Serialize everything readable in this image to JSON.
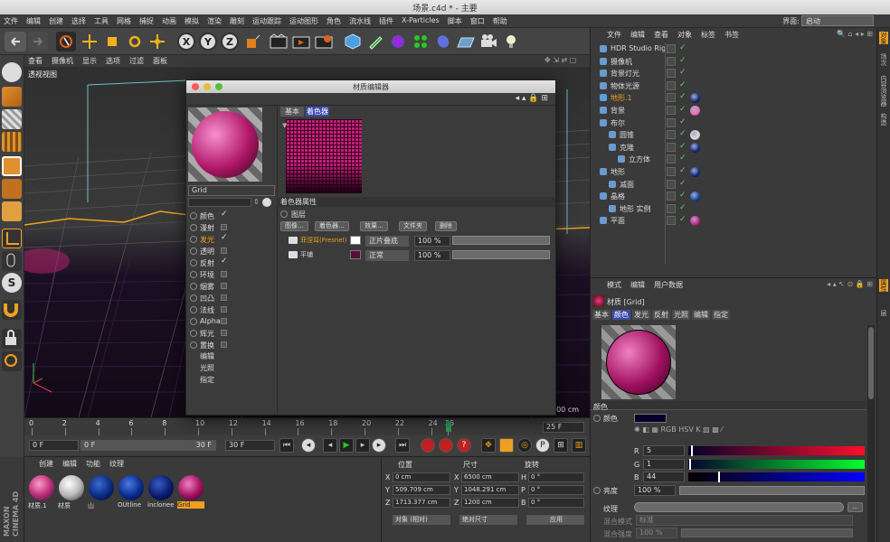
{
  "window": {
    "title": "场景.c4d * - 主要"
  },
  "menu": {
    "items": [
      "文件",
      "编辑",
      "创建",
      "选择",
      "工具",
      "网格",
      "捕捉",
      "动画",
      "模拟",
      "渲染",
      "雕刻",
      "运动跟踪",
      "运动图形",
      "角色",
      "流水线",
      "插件",
      "X-Particles",
      "脚本",
      "窗口",
      "帮助"
    ],
    "interface_label": "界面:",
    "interface_value": "启动"
  },
  "viewport": {
    "menu": [
      "查看",
      "摄像机",
      "显示",
      "选项",
      "过滤",
      "面板"
    ],
    "label": "透视视图",
    "distance": "000 cm"
  },
  "timeline": {
    "ticks": [
      "0",
      "2",
      "4",
      "6",
      "8",
      "10",
      "12",
      "14",
      "16",
      "18",
      "20",
      "22",
      "24",
      "25"
    ],
    "current": "25 F"
  },
  "transport": {
    "start": "0 F",
    "preview_start": "0 F",
    "preview_end": "30 F",
    "end": "30 F"
  },
  "material_manager": {
    "menu": [
      "创建",
      "编辑",
      "功能",
      "纹理"
    ],
    "materials": [
      "材质.1",
      "材质",
      "山",
      "OUtline",
      "inclonee",
      "Grid"
    ],
    "brand_line1": "MAXON",
    "brand_line2": "CINEMA 4D"
  },
  "coordinates": {
    "headers": [
      "位置",
      "尺寸",
      "旋转"
    ],
    "rows": [
      {
        "axis": "X",
        "pos": "0 cm",
        "size": "6500 cm",
        "rot_axis": "H",
        "rot": "0 °"
      },
      {
        "axis": "Y",
        "pos": "509.709 cm",
        "size": "1048.291 cm",
        "rot_axis": "P",
        "rot": "0 °"
      },
      {
        "axis": "Z",
        "pos": "1713.377 cm",
        "size": "1200 cm",
        "rot_axis": "B",
        "rot": "0 °"
      }
    ],
    "mode_select": "对象 (相对)",
    "size_select": "绝对尺寸",
    "apply": "应用"
  },
  "object_manager": {
    "menu": [
      "文件",
      "编辑",
      "查看",
      "对象",
      "标签",
      "书签"
    ],
    "objects": [
      {
        "name": "HDR Studio Rig",
        "indent": 0,
        "color": "#ddd"
      },
      {
        "name": "摄像机",
        "indent": 0,
        "color": "#ddd"
      },
      {
        "name": "背景灯光",
        "indent": 0,
        "color": "#ddd"
      },
      {
        "name": "物体光源",
        "indent": 0,
        "color": "#ddd"
      },
      {
        "name": "地形.1",
        "indent": 0,
        "color": "#f0a020"
      },
      {
        "name": "背景",
        "indent": 0,
        "color": "#ddd"
      },
      {
        "name": "布尔",
        "indent": 0,
        "color": "#ddd"
      },
      {
        "name": "圆锥",
        "indent": 1,
        "color": "#ddd"
      },
      {
        "name": "克隆",
        "indent": 1,
        "color": "#ddd"
      },
      {
        "name": "立方体",
        "indent": 2,
        "color": "#ddd"
      },
      {
        "name": "地形",
        "indent": 0,
        "color": "#ddd"
      },
      {
        "name": "减面",
        "indent": 1,
        "color": "#ddd"
      },
      {
        "name": "晶格",
        "indent": 0,
        "color": "#ddd"
      },
      {
        "name": "地形 实例",
        "indent": 1,
        "color": "#ddd"
      },
      {
        "name": "平面",
        "indent": 0,
        "color": "#ddd"
      }
    ]
  },
  "attributes": {
    "menu": [
      "模式",
      "编辑",
      "用户数据"
    ],
    "title": "材质 [Grid]",
    "tabs": [
      "基本",
      "颜色",
      "发光",
      "反射",
      "光照",
      "编辑",
      "指定"
    ],
    "active_tab": "颜色",
    "section": "颜色",
    "color_label": "颜色",
    "r": "5",
    "g": "1",
    "b": "44",
    "r_label": "R",
    "g_label": "G",
    "b_label": "B",
    "brightness_label": "亮度",
    "brightness": "100 %",
    "texture_label": "纹理",
    "blend_mode_label": "混合模式",
    "blend_mode": "标准",
    "blend_strength_label": "混合强度",
    "blend_strength": "100 %",
    "swatch_color": "#05012c"
  },
  "right_tabs": [
    "对象",
    "场次",
    "内容浏览器",
    "构造",
    "属性",
    "层"
  ],
  "dialog": {
    "title": "材质编辑器",
    "material_name": "Grid",
    "tabs": [
      "基本",
      "着色器"
    ],
    "channels": [
      {
        "name": "颜色",
        "checked": true,
        "active": false
      },
      {
        "name": "漫射",
        "checked": false,
        "active": false
      },
      {
        "name": "发光",
        "checked": true,
        "active": true
      },
      {
        "name": "透明",
        "checked": false,
        "active": false
      },
      {
        "name": "反射",
        "checked": true,
        "active": false
      },
      {
        "name": "环境",
        "checked": false,
        "active": false
      },
      {
        "name": "烟雾",
        "checked": false,
        "active": false
      },
      {
        "name": "凹凸",
        "checked": false,
        "active": false
      },
      {
        "name": "法线",
        "checked": false,
        "active": false
      },
      {
        "name": "Alpha",
        "checked": false,
        "active": false
      },
      {
        "name": "辉光",
        "checked": false,
        "active": false
      },
      {
        "name": "置换",
        "checked": false,
        "active": false
      }
    ],
    "extra": [
      "编辑",
      "光照",
      "指定"
    ],
    "shader_props": "着色器属性",
    "layer_label": "图层",
    "buttons": [
      "图像...",
      "着色器...",
      "效果...",
      "文件夹",
      "删除"
    ],
    "layers": [
      {
        "name": "菲涅耳(Fresnel)",
        "mode": "正片叠底",
        "pct": "100 %",
        "color": "#ffffff",
        "name_color": "#f0a020"
      },
      {
        "name": "平铺",
        "mode": "正常",
        "pct": "100 %",
        "color": "#5a0f3a",
        "name_color": "#ddd"
      }
    ]
  },
  "colors": {
    "accent": "#f0a020",
    "grid": "#c0207a",
    "active_tab": "#3c4aa8"
  }
}
